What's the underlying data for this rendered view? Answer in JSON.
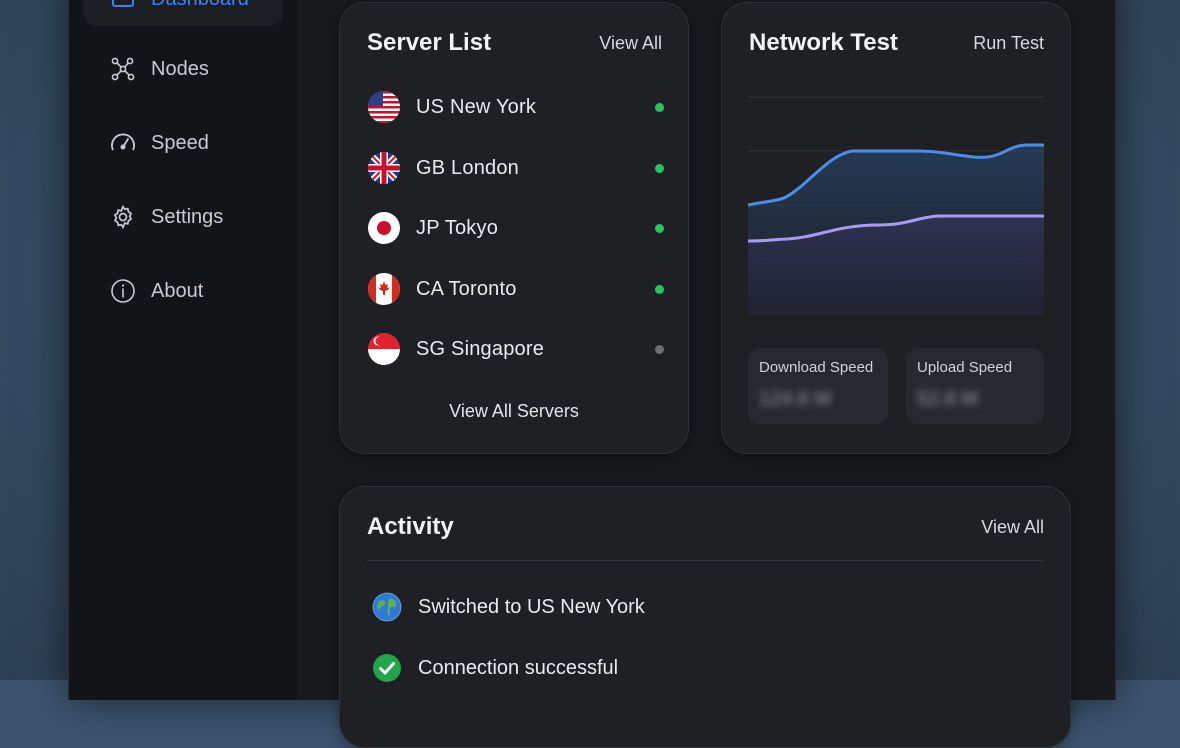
{
  "sidebar": {
    "items": [
      {
        "label": "Dashboard",
        "icon": "dashboard-icon",
        "active": true
      },
      {
        "label": "Nodes",
        "icon": "nodes-icon"
      },
      {
        "label": "Speed",
        "icon": "speedometer-icon"
      },
      {
        "label": "Settings",
        "icon": "gear-icon"
      },
      {
        "label": "About",
        "icon": "info-icon"
      }
    ]
  },
  "server_list": {
    "title": "Server List",
    "action": "View All",
    "footer": "View All Servers",
    "servers": [
      {
        "name": "US New York",
        "status": "online"
      },
      {
        "name": "GB London",
        "status": "online"
      },
      {
        "name": "JP Tokyo",
        "status": "online"
      },
      {
        "name": "CA Toronto",
        "status": "online"
      },
      {
        "name": "SG Singapore",
        "status": "offline"
      }
    ]
  },
  "network_test": {
    "title": "Network Test",
    "action": "Run Test",
    "download_label": "Download Speed",
    "download_value": "124.6 M",
    "upload_label": "Upload Speed",
    "upload_value": "52.8 M"
  },
  "activity": {
    "title": "Activity",
    "action": "View All",
    "items": [
      {
        "text": "Switched to US New York",
        "icon": "globe-icon"
      },
      {
        "text": "Connection successful",
        "icon": "check-circle-icon"
      }
    ]
  },
  "colors": {
    "accent": "#3b82f6",
    "online": "#22c55e",
    "offline": "#6b7078",
    "download_line": "#4a8ee8",
    "upload_line": "#a89cf0"
  }
}
